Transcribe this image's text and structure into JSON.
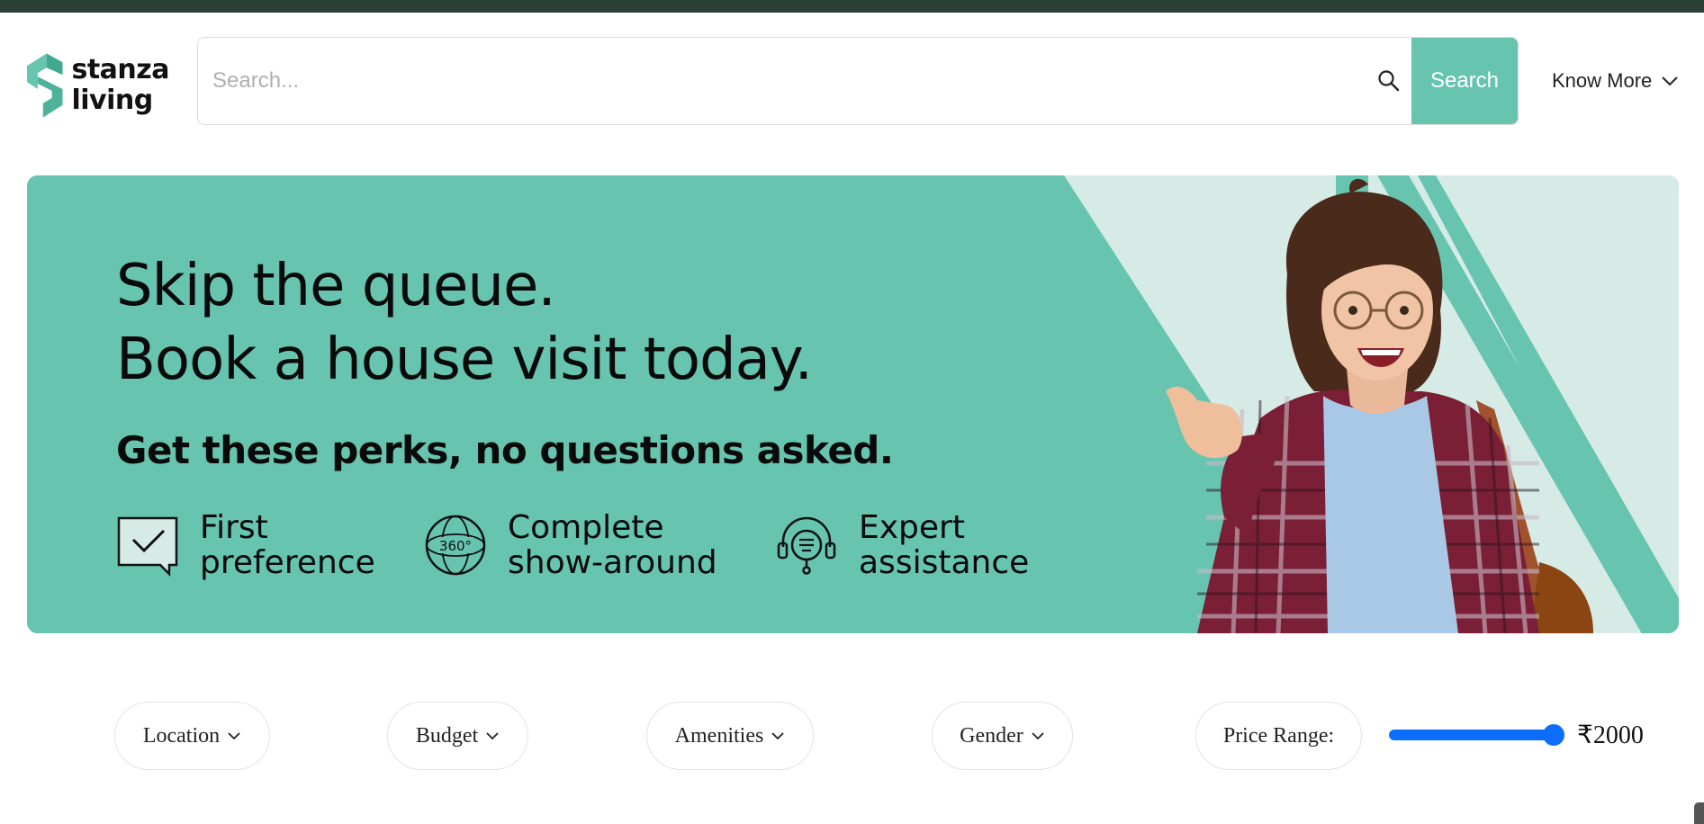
{
  "brand": {
    "line1": "stanza",
    "line2": "living",
    "color": "#66c4af"
  },
  "header": {
    "search_placeholder": "Search...",
    "search_button": "Search",
    "know_more": "Know More"
  },
  "banner": {
    "headline_line1": "Skip the queue.",
    "headline_line2": "Book a house visit today.",
    "subhead": "Get these perks, no questions asked.",
    "perks": [
      {
        "icon": "chat-check-icon",
        "line1": "First",
        "line2": "preference"
      },
      {
        "icon": "globe-360-icon",
        "line1": "Complete",
        "line2": "show-around"
      },
      {
        "icon": "support-headset-icon",
        "line1": "Expert",
        "line2": "assistance"
      }
    ],
    "badge_360": "360°"
  },
  "filters": {
    "location": "Location",
    "budget": "Budget",
    "amenities": "Amenities",
    "gender": "Gender",
    "price_label": "Price Range:",
    "price_value": "₹2000"
  },
  "colors": {
    "accent": "#66c4af",
    "topbar": "#2d4038",
    "slider": "#0d6efd"
  }
}
